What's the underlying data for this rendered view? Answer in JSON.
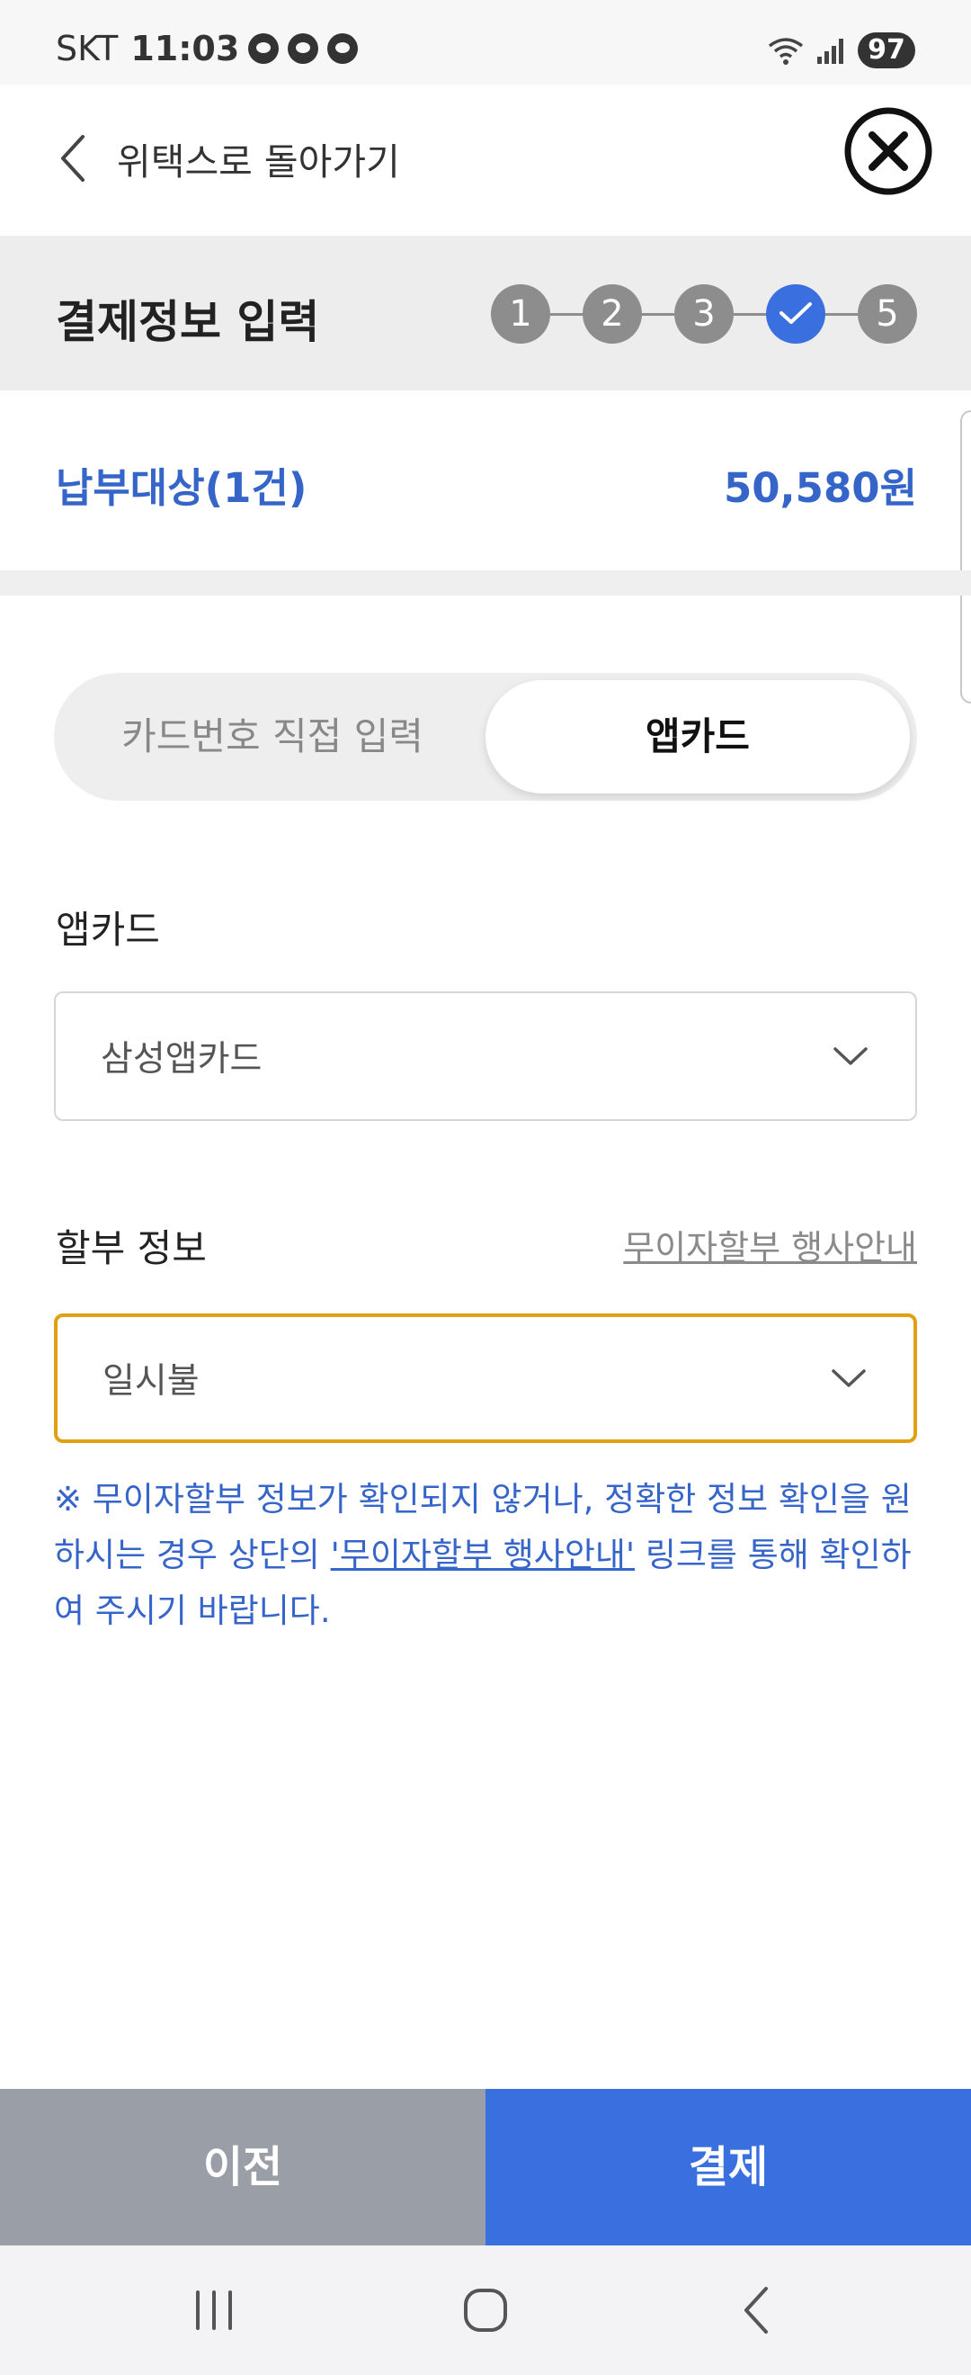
{
  "status_bar": {
    "carrier": "SKT",
    "time": "11:03",
    "battery": "97"
  },
  "header": {
    "back_label": "위택스로 돌아가기"
  },
  "step_bar": {
    "title": "결제정보 입력",
    "steps": [
      "1",
      "2",
      "3",
      "",
      "5"
    ],
    "current_step": 4
  },
  "payment_target": {
    "label": "납부대상(1건)",
    "amount": "50,580원"
  },
  "tabs": {
    "card_number": "카드번호 직접 입력",
    "app_card": "앱카드",
    "selected": "앱카드"
  },
  "app_card_field": {
    "label": "앱카드",
    "value": "삼성앱카드"
  },
  "installment_field": {
    "label": "할부 정보",
    "link": "무이자할부 행사안내",
    "value": "일시불"
  },
  "notice": {
    "part1": "※ 무이자할부 정보가 확인되지 않거나, 정확한 정보 확인을 원하시는 경우 상단의 ",
    "link": "'무이자할부 행사안내'",
    "part2": " 링크를 통해 확인하여 주시기 바랍니다."
  },
  "buttons": {
    "prev": "이전",
    "pay": "결제"
  },
  "colors": {
    "accent": "#3a6fe0",
    "amount_text": "#3665c9",
    "focus_border": "#e0a012",
    "prev_button": "#9a9ea6"
  }
}
